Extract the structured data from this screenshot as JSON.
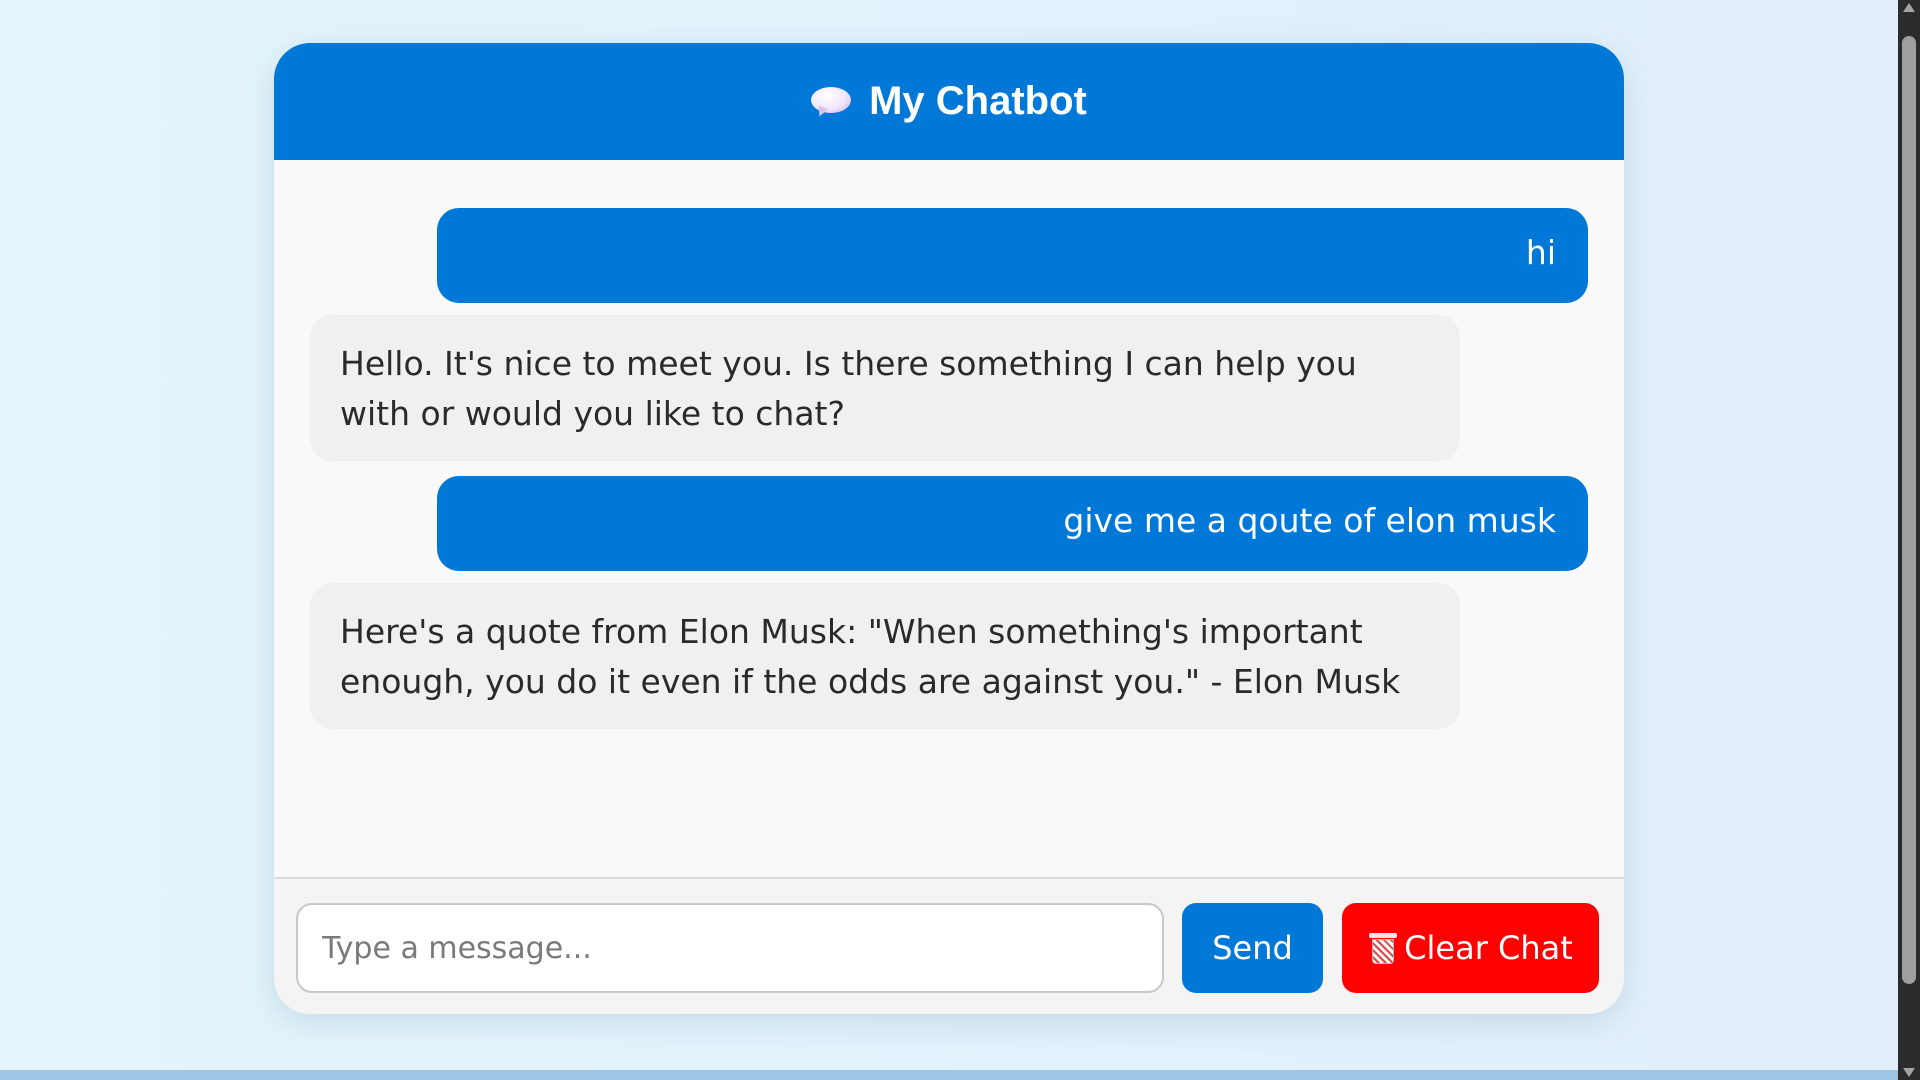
{
  "header": {
    "title": "My Chatbot",
    "icon": "speech-bubble-icon"
  },
  "messages": [
    {
      "role": "user",
      "text": "hi"
    },
    {
      "role": "bot",
      "text": "Hello. It's nice to meet you. Is there something I can help you with or would you like to chat?"
    },
    {
      "role": "user",
      "text": "give me a qoute of elon musk"
    },
    {
      "role": "bot",
      "text": "Here's a quote from Elon Musk: \"When something's important enough, you do it even if the odds are against you.\" - Elon Musk"
    }
  ],
  "input": {
    "placeholder": "Type a message...",
    "value": ""
  },
  "buttons": {
    "send_label": "Send",
    "clear_label": "Clear Chat",
    "clear_icon": "trash-icon"
  },
  "colors": {
    "accent": "#0078d7",
    "danger": "#ff0000",
    "bot_bubble": "#f0f0f0"
  }
}
